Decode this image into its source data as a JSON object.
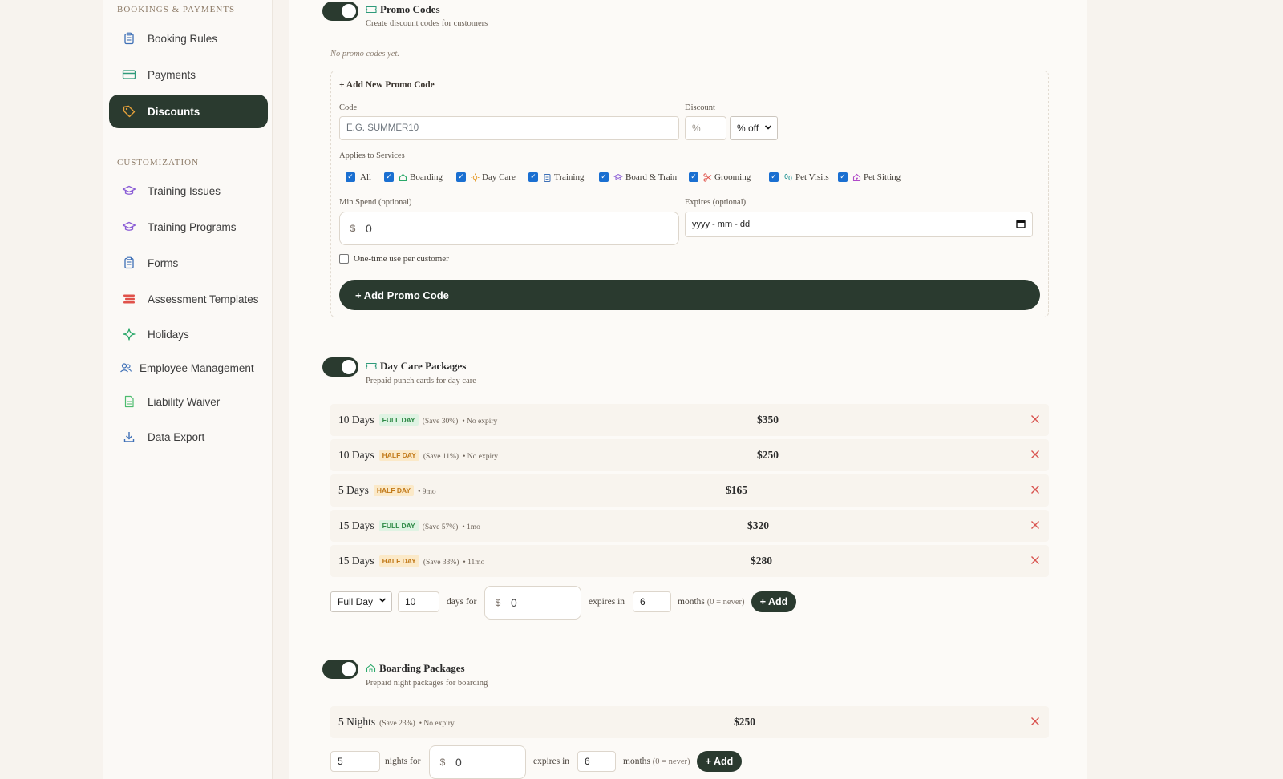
{
  "sidebar": {
    "section_bookings": "BOOKINGS & PAYMENTS",
    "section_customization": "CUSTOMIZATION",
    "items": [
      {
        "label": "Booking Rules",
        "icon": "clipboard-icon"
      },
      {
        "label": "Payments",
        "icon": "credit-card-icon"
      },
      {
        "label": "Discounts",
        "icon": "tag-icon",
        "active": true
      },
      {
        "label": "Training Issues",
        "icon": "graduation-cap-icon"
      },
      {
        "label": "Training Programs",
        "icon": "graduation-cap-icon"
      },
      {
        "label": "Forms",
        "icon": "clipboard-icon"
      },
      {
        "label": "Assessment Templates",
        "icon": "layers-icon"
      },
      {
        "label": "Holidays",
        "icon": "sparkle-icon"
      },
      {
        "label": "Employee Management",
        "icon": "users-icon"
      },
      {
        "label": "Liability Waiver",
        "icon": "document-icon"
      },
      {
        "label": "Data Export",
        "icon": "download-icon"
      }
    ]
  },
  "promo": {
    "title": "Promo Codes",
    "subtitle": "Create discount codes for customers",
    "enabled": true,
    "empty_note": "No promo codes yet.",
    "form": {
      "heading": "+ Add New Promo Code",
      "code_label": "Code",
      "code_placeholder": "E.G. SUMMER10",
      "discount_label": "Discount",
      "discount_placeholder": "%",
      "discount_type": "% off",
      "applies_label": "Applies to Services",
      "services": [
        {
          "label": "All",
          "checked": true,
          "icon": ""
        },
        {
          "label": "Boarding",
          "checked": true,
          "icon": "house-icon"
        },
        {
          "label": "Day Care",
          "checked": true,
          "icon": "sun-icon"
        },
        {
          "label": "Training",
          "checked": true,
          "icon": "clipboard-icon"
        },
        {
          "label": "Board & Train",
          "checked": true,
          "icon": "graduation-cap-icon"
        },
        {
          "label": "Grooming",
          "checked": true,
          "icon": "scissors-icon"
        },
        {
          "label": "Pet Visits",
          "checked": true,
          "icon": "footprints-icon"
        },
        {
          "label": "Pet Sitting",
          "checked": true,
          "icon": "house-heart-icon"
        }
      ],
      "min_spend_label": "Min Spend (optional)",
      "min_spend_currency": "$",
      "min_spend_value": "0",
      "expires_label": "Expires (optional)",
      "expires_placeholder": "yyyy - mm - dd",
      "one_time_label": "One-time use per customer",
      "one_time_checked": false,
      "submit_label": "+ Add Promo Code"
    }
  },
  "daycare": {
    "title": "Day Care Packages",
    "subtitle": "Prepaid punch cards for day care",
    "enabled": true,
    "packages": [
      {
        "name": "10 Days",
        "badge": "FULL DAY",
        "badge_type": "full",
        "save": "(Save 30%)",
        "expiry": "• No expiry",
        "price": "$350"
      },
      {
        "name": "10 Days",
        "badge": "HALF DAY",
        "badge_type": "half",
        "save": "(Save 11%)",
        "expiry": "• No expiry",
        "price": "$250"
      },
      {
        "name": "5 Days",
        "badge": "HALF DAY",
        "badge_type": "half",
        "save": "",
        "expiry": "• 9mo",
        "price": "$165"
      },
      {
        "name": "15 Days",
        "badge": "FULL DAY",
        "badge_type": "full",
        "save": "(Save 57%)",
        "expiry": "• 1mo",
        "price": "$320"
      },
      {
        "name": "15 Days",
        "badge": "HALF DAY",
        "badge_type": "half",
        "save": "(Save 33%)",
        "expiry": "• 11mo",
        "price": "$280"
      }
    ],
    "add": {
      "type": "Full Day",
      "days": "10",
      "days_for": "days for",
      "currency": "$",
      "price": "0",
      "expires_in": "expires in",
      "months": "6",
      "months_label": "months",
      "never_hint": "(0 = never)",
      "button": "+ Add"
    }
  },
  "boarding": {
    "title": "Boarding Packages",
    "subtitle": "Prepaid night packages for boarding",
    "enabled": true,
    "packages": [
      {
        "name": "5 Nights",
        "save": "(Save 23%)",
        "expiry": "• No expiry",
        "price": "$250"
      }
    ],
    "add": {
      "nights": "5",
      "nights_for": "nights for",
      "currency": "$",
      "price": "0",
      "expires_in": "expires in",
      "months": "6",
      "months_label": "months",
      "never_hint": "(0 = never)",
      "button": "+ Add"
    }
  },
  "colors": {
    "accent": "#2a3a2f",
    "delete": "#d9534f",
    "full_badge": "#2e8a46",
    "half_badge": "#c27a1a"
  }
}
